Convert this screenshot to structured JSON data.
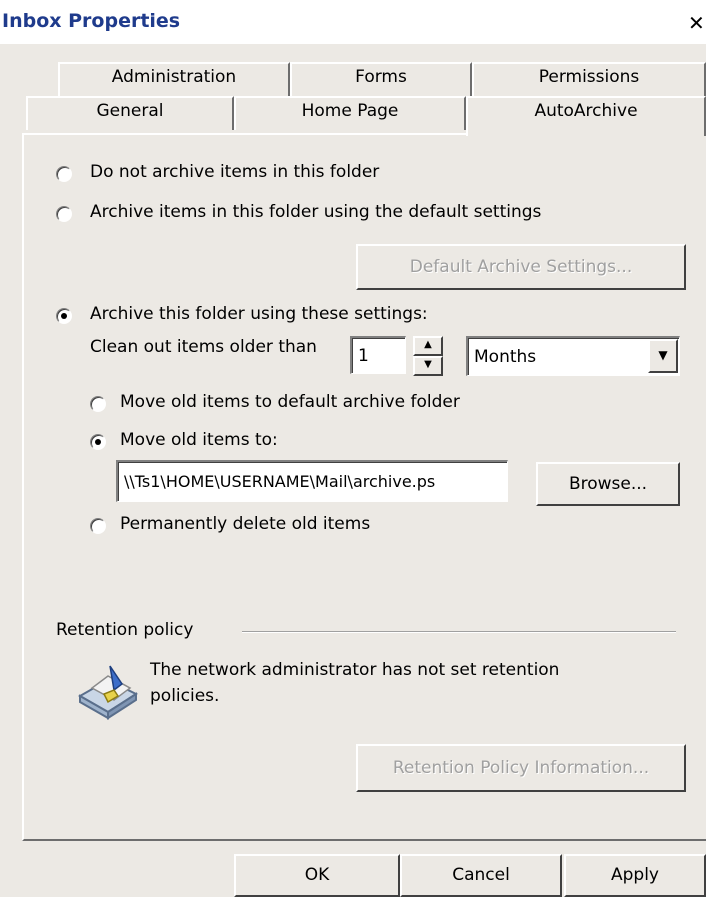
{
  "window": {
    "title": "Inbox Properties",
    "close": "✕"
  },
  "tabs": {
    "row1": [
      "Administration",
      "Forms",
      "Permissions"
    ],
    "row2": [
      "General",
      "Home Page",
      "AutoArchive"
    ],
    "active": "AutoArchive"
  },
  "autoarchive": {
    "opt_no_archive": "Do not archive items in this folder",
    "opt_default": "Archive items in this folder using the default settings",
    "default_settings_button": "Default Archive Settings...",
    "opt_custom": "Archive this folder using these settings:",
    "clean_out_label": "Clean out items older than",
    "age_value": "1",
    "age_unit": "Months",
    "opt_move_default": "Move old items to default archive folder",
    "opt_move_to": "Move old items to:",
    "move_path": "\\\\Ts1\\HOME\\USERNAME\\Mail\\archive.ps",
    "browse_button": "Browse...",
    "opt_delete": "Permanently delete old items",
    "selected": {
      "archive_mode": "custom",
      "old_items_action": "move_to"
    }
  },
  "retention": {
    "heading": "Retention policy",
    "message_line1": "The network administrator has not set retention",
    "message_line2": "policies.",
    "info_button": "Retention Policy Information..."
  },
  "footer": {
    "ok": "OK",
    "cancel": "Cancel",
    "apply": "Apply"
  }
}
